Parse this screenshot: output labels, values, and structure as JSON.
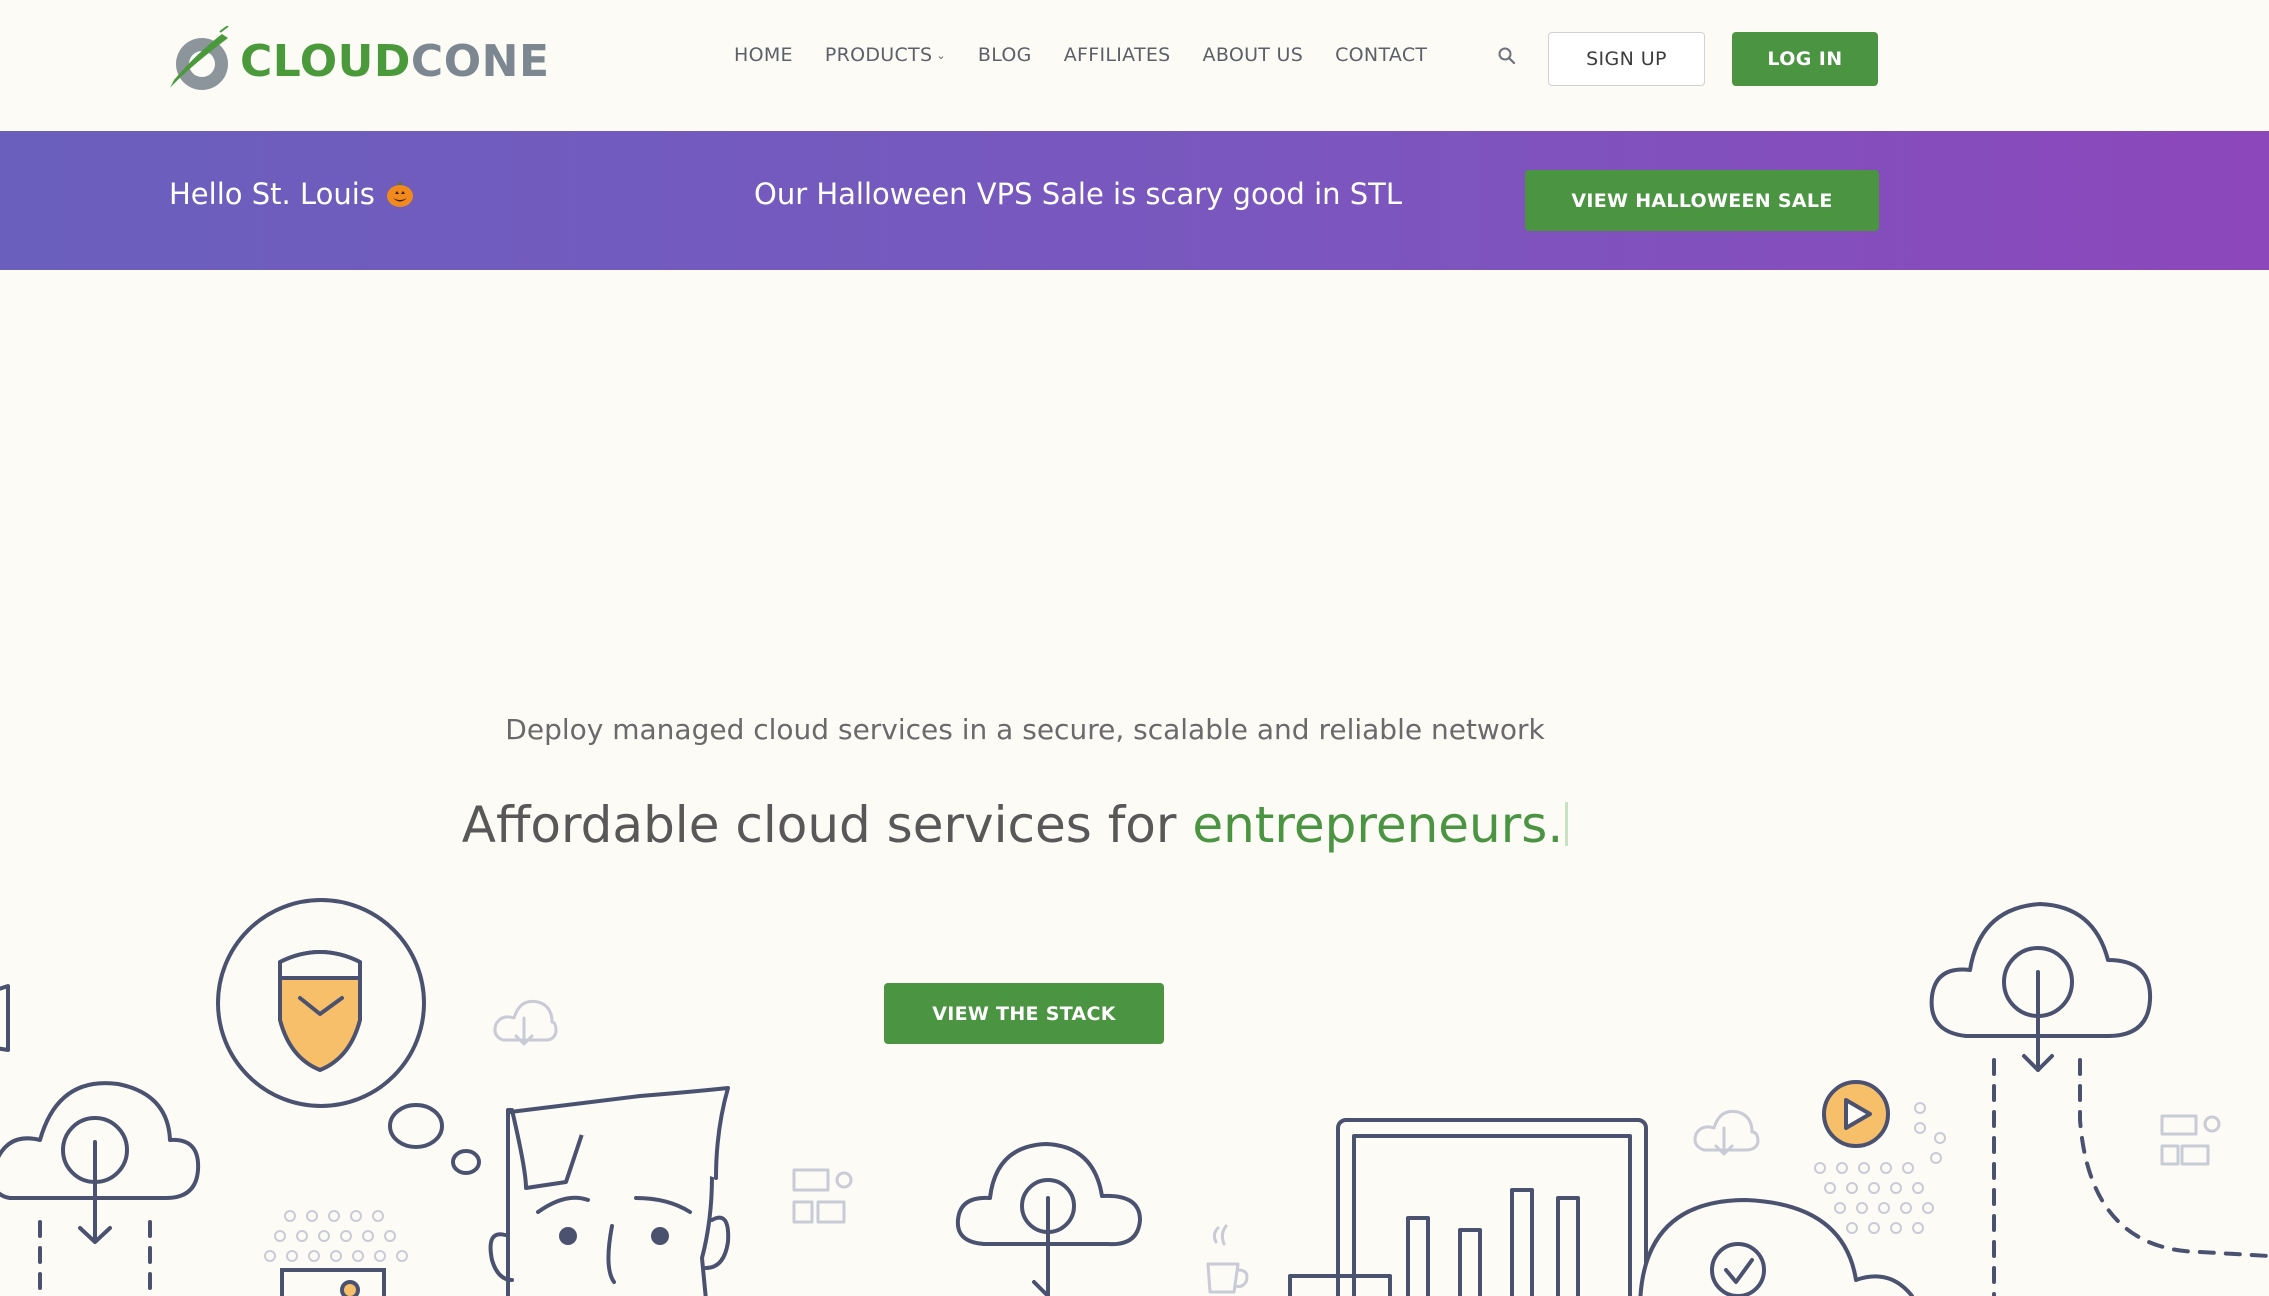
{
  "header": {
    "logo": {
      "part1": "CLOUD",
      "part2": "CONE"
    },
    "nav": [
      {
        "label": "HOME"
      },
      {
        "label": "PRODUCTS",
        "has_dropdown": true
      },
      {
        "label": "BLOG"
      },
      {
        "label": "AFFILIATES"
      },
      {
        "label": "ABOUT US"
      },
      {
        "label": "CONTACT"
      }
    ],
    "search_icon": "search-icon",
    "signup_label": "SIGN UP",
    "login_label": "LOG IN"
  },
  "banner": {
    "greeting": "Hello St. Louis",
    "greeting_icon": "pumpkin-icon",
    "message": "Our Halloween VPS Sale is scary good in STL",
    "button_label": "VIEW HALLOWEEN SALE"
  },
  "hero": {
    "subtitle": "Deploy managed cloud services in a secure, scalable and reliable network",
    "title_prefix": "Affordable cloud services for ",
    "title_accent": "entrepreneurs.",
    "button_label": "VIEW THE STACK"
  },
  "colors": {
    "brand_green": "#4a9442",
    "banner_start": "#6a5fbd",
    "banner_end": "#8c47bb",
    "background": "#fcfbf6",
    "line_art": "#4a5270",
    "accent_orange": "#f8bf6a"
  }
}
